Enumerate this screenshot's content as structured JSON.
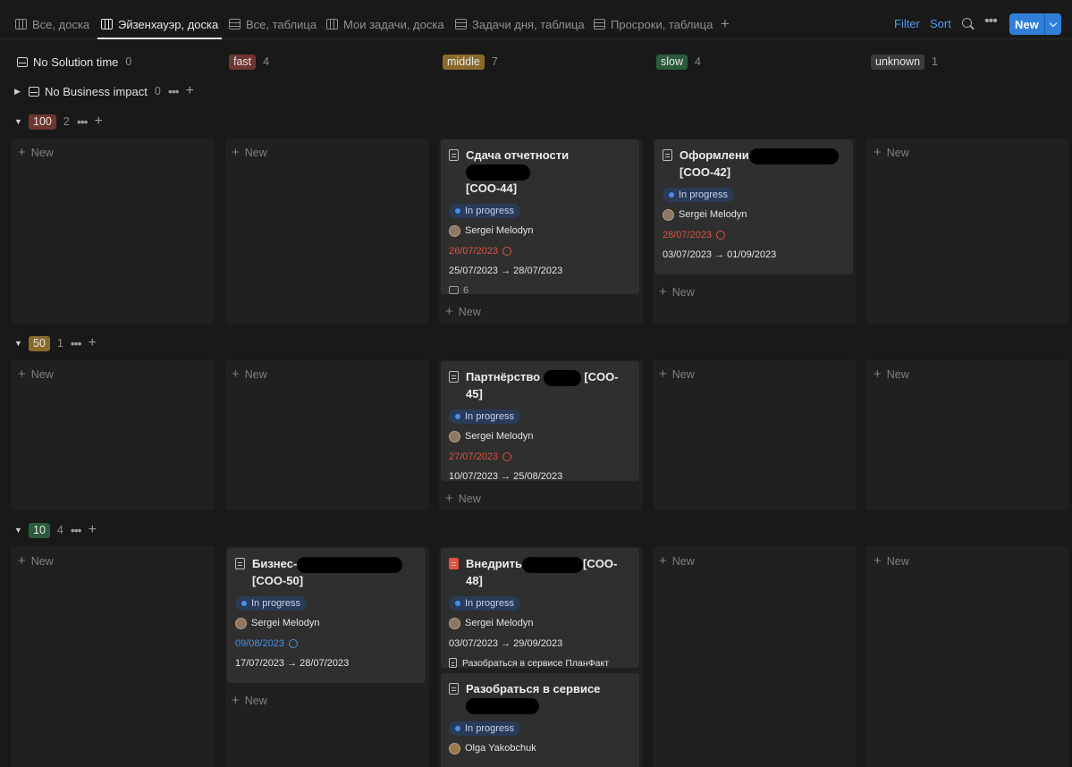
{
  "tabs": [
    {
      "label": "Все, доска",
      "icon": "board-icon"
    },
    {
      "label": "Эйзенхауэр, доска",
      "icon": "board-icon",
      "active": true
    },
    {
      "label": "Все, таблица",
      "icon": "table-icon"
    },
    {
      "label": "Мои задачи, доска",
      "icon": "board-icon"
    },
    {
      "label": "Задачи дня, таблица",
      "icon": "table-icon"
    },
    {
      "label": "Просроки, таблица",
      "icon": "table-icon"
    }
  ],
  "toolbar": {
    "filter": "Filter",
    "sort": "Sort",
    "new": "New"
  },
  "columns": [
    {
      "label": "No Solution time",
      "count": "0"
    },
    {
      "label": "fast",
      "count": "4",
      "color": "#6e3630"
    },
    {
      "label": "middle",
      "count": "7",
      "color": "#8a6a2c"
    },
    {
      "label": "slow",
      "count": "4",
      "color": "#2b5a3d"
    },
    {
      "label": "unknown",
      "count": "1",
      "color": "#3b3b3b"
    }
  ],
  "groups": [
    {
      "label": "No Business impact",
      "count": "0"
    },
    {
      "label": "100",
      "count": "2",
      "color": "#6e3630"
    },
    {
      "label": "50",
      "count": "1",
      "color": "#8a6a2c"
    },
    {
      "label": "10",
      "count": "4",
      "color": "#2b5a3d"
    }
  ],
  "lane_new": "New",
  "cards": {
    "c44": {
      "title_pre": "Сдача отчетности",
      "title_post": "[COO-44]",
      "status": "In progress",
      "assignee": "Sergei Melodyn",
      "due": "26/07/2023",
      "range": "25/07/2023 → 28/07/2023",
      "comments": "6"
    },
    "c42": {
      "title_pre": "Оформлени",
      "title_post": "[COO-42]",
      "status": "In progress",
      "assignee": "Sergei Melodyn",
      "due": "28/07/2023",
      "range": "03/07/2023 → 01/09/2023"
    },
    "c45": {
      "title_pre": "Партнёрство",
      "title_post": "[COO-45]",
      "status": "In progress",
      "assignee": "Sergei Melodyn",
      "due": "27/07/2023",
      "range": "10/07/2023 → 25/08/2023"
    },
    "c50": {
      "title_pre": "Бизнес-",
      "title_post": "[COO-50]",
      "status": "In progress",
      "assignee": "Sergei Melodyn",
      "due": "09/08/2023",
      "range": "17/07/2023 → 28/07/2023"
    },
    "c48": {
      "title_pre": "Внедрить",
      "title_post": "[COO-48]",
      "status": "In progress",
      "assignee": "Sergei Melodyn",
      "range": "03/07/2023 → 29/09/2023",
      "subitem": "Разобраться в сервисе ПланФакт"
    },
    "cx": {
      "title_pre": "Разобраться в сервисе",
      "status": "In progress",
      "assignee": "Olga Yakobchuk"
    }
  }
}
